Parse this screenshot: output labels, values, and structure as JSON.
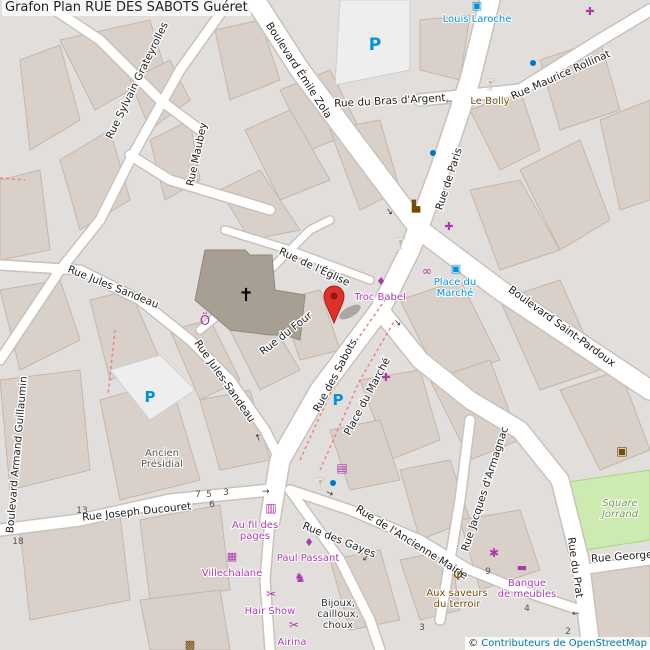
{
  "title": "Grafon Plan RUE DES SABOTS Guéret",
  "attribution": {
    "prefix": "©",
    "link_text": "Contributeurs de OpenStreetMap"
  },
  "colors": {
    "background": "#e2dedb",
    "building": "#d9d0c9",
    "building_edge": "#c4b6ab",
    "road": "#ffffff",
    "road_edge": "#c8c2bb",
    "park": "#cdebb0",
    "church": "#a79f94",
    "parking_area": "#eeeeee",
    "poi_magenta": "#ac39ac",
    "poi_brown": "#734a08",
    "poi_blue": "#0092da",
    "marker": "#e0302b"
  },
  "street_labels": [
    "Boulevard Émile Zola",
    "Rue du Bras d'Argent",
    "Rue Maurice Rollinat",
    "Rue Sylvain Grateyrolles",
    "Rue Maubey",
    "Rue de Paris",
    "Rue de l'Église",
    "Rue Jules Sandeau",
    "Rue Jules-Sandeau",
    "Rue du Four",
    "Rue des Sabots",
    "Place du Marché",
    "Boulevard Saint-Pardoux",
    "Boulevard Armand Guillaumin",
    "Rue Joseph Ducouret",
    "Rue des Gayes",
    "Rue de l'Ancienne Mairie",
    "Rue Jacques d'Armagnac",
    "Rue du Prat",
    "Rue George"
  ],
  "poi_labels": [
    "Louis Laroche",
    "Le Bolly",
    "Troc Babel",
    "Place du Marché",
    "Ancien Présidial",
    "Au fil des pages",
    "Paul Passant",
    "Villechalane",
    "Hair Show",
    "Airina",
    "Bijoux, cailloux, choux",
    "Aux saveurs du terroir",
    "Banque de meubles",
    "Square Jorrand"
  ],
  "house_numbers": [
    "7",
    "5",
    "3",
    "6",
    "13",
    "18",
    "9",
    "4",
    "2",
    "3"
  ],
  "icons": {
    "parking": "P",
    "church": "latin-cross-icon",
    "bus": "bus-icon",
    "pharmacy": "pharmacy-icon",
    "bar": "cocktail-glass-icon",
    "optician": "glasses-icon",
    "clothes": "tshirt-icon",
    "bookshop": "book-icon",
    "jewelry": "ring-icon",
    "toys": "rocking-horse-icon",
    "hairdresser": "scissors-icon",
    "deli": "bakery-icon",
    "furniture": "sofa-icon",
    "dance": "dancer-icon",
    "restaurant": "knife-fork-icon",
    "cinema": "film-icon",
    "waste": "bin-icon",
    "marker": "map-pin-icon"
  }
}
